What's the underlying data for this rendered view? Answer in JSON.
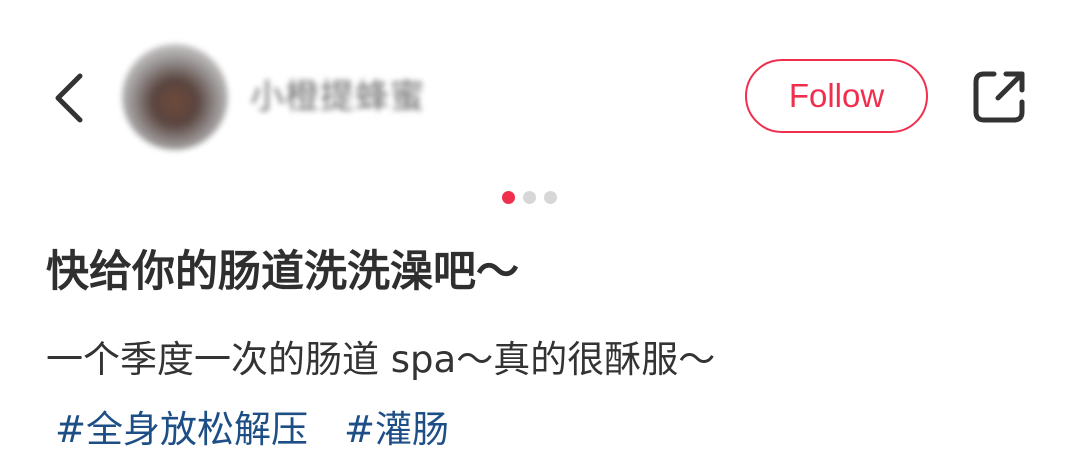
{
  "header": {
    "back_icon": "chevron-left-icon",
    "username": "小橙提蜂蜜",
    "follow_label": "Follow",
    "follow_color": "#ef2f4d",
    "share_icon": "share-external-icon"
  },
  "pager": {
    "count": 3,
    "active_index": 0,
    "active_color": "#ef2f4d"
  },
  "post": {
    "title": "快给你的肠道洗洗澡吧～",
    "description": "一个季度一次的肠道 spa～真的很酥服～",
    "tags": [
      "#全身放松解压",
      "#灌肠"
    ],
    "tag_color": "#1d4f86"
  }
}
